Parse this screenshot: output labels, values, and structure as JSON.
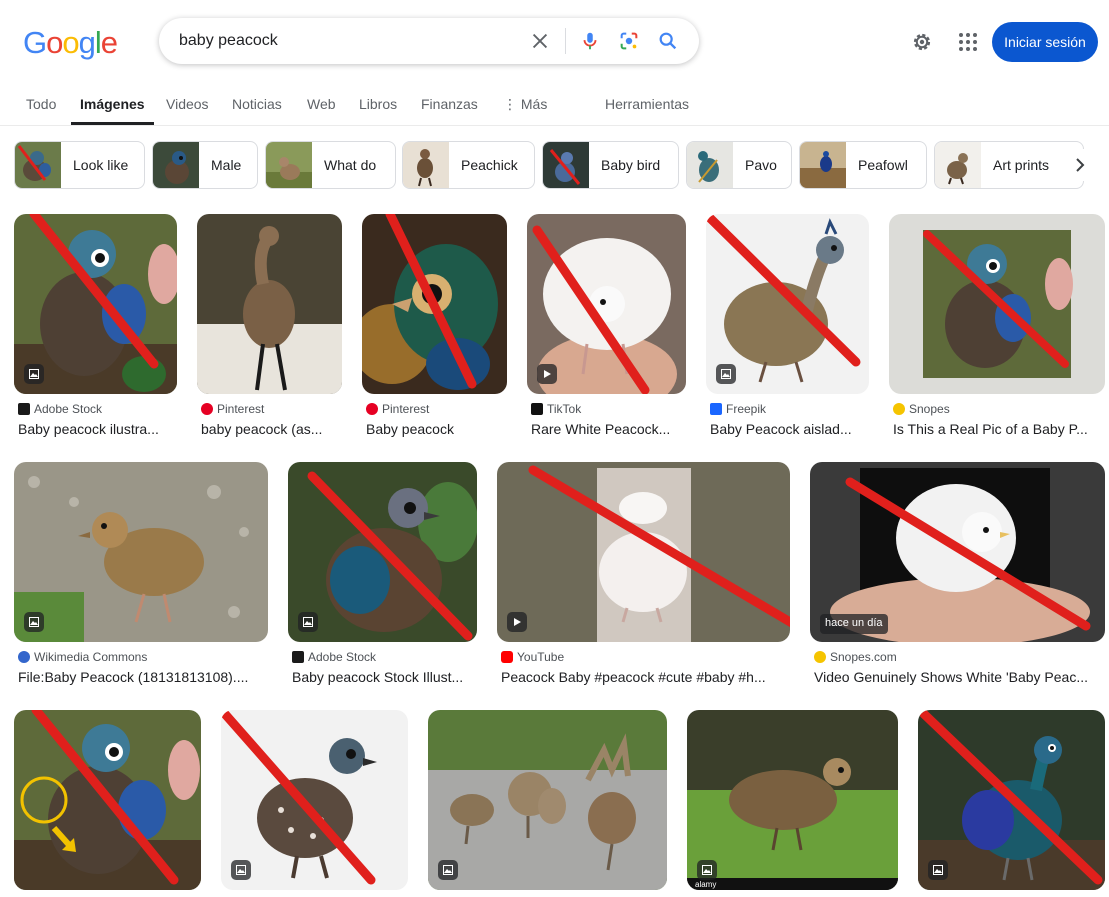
{
  "logo": {
    "letters": [
      "G",
      "o",
      "o",
      "g",
      "l",
      "e"
    ],
    "colors": [
      "#4285f4",
      "#ea4335",
      "#fbbc05",
      "#4285f4",
      "#34a853",
      "#ea4335"
    ]
  },
  "search": {
    "query": "baby peacock"
  },
  "header": {
    "signin_label": "Iniciar sesión"
  },
  "tabs": [
    "Todo",
    "Imágenes",
    "Videos",
    "Noticias",
    "Web",
    "Libros",
    "Finanzas",
    "Más",
    "Herramientas"
  ],
  "active_tab": "Imágenes",
  "chips": [
    "Look like",
    "Male",
    "What do",
    "Peachick",
    "Baby bird",
    "Pavo",
    "Peafowl",
    "Art prints"
  ],
  "results": [
    {
      "source": "Adobe Stock",
      "title": "Baby peacock ilustra...",
      "badge": "image"
    },
    {
      "source": "Pinterest",
      "title": "baby peacock (as...",
      "badge": "none"
    },
    {
      "source": "Pinterest",
      "title": "Baby peacock",
      "badge": "none"
    },
    {
      "source": "TikTok",
      "title": "Rare White Peacock...",
      "badge": "video"
    },
    {
      "source": "Freepik",
      "title": "Baby Peacock aislad...",
      "badge": "image"
    },
    {
      "source": "Snopes",
      "title": "Is This a Real Pic of a Baby P...",
      "badge": "none"
    },
    {
      "source": "Wikimedia Commons",
      "title": "File:Baby Peacock (18131813108)....",
      "badge": "image"
    },
    {
      "source": "Adobe Stock",
      "title": "Baby peacock Stock Illust...",
      "badge": "image"
    },
    {
      "source": "YouTube",
      "title": "Peacock Baby #peacock #cute #baby #h...",
      "badge": "video"
    },
    {
      "source": "Snopes.com",
      "title": "Video Genuinely Shows White 'Baby Peac...",
      "badge": "time",
      "time_label": "hace un día"
    },
    {
      "source": "",
      "title": "",
      "badge": "none"
    },
    {
      "source": "",
      "title": "",
      "badge": "image"
    },
    {
      "source": "",
      "title": "",
      "badge": "image"
    },
    {
      "source": "",
      "title": "",
      "badge": "image"
    },
    {
      "source": "",
      "title": "",
      "badge": "image"
    }
  ],
  "watermarks": {
    "alamy": "alamy"
  },
  "colors": {
    "accent": "#0b57d0",
    "strike": "#e0201c",
    "text": "#202124",
    "muted": "#5f6368"
  }
}
